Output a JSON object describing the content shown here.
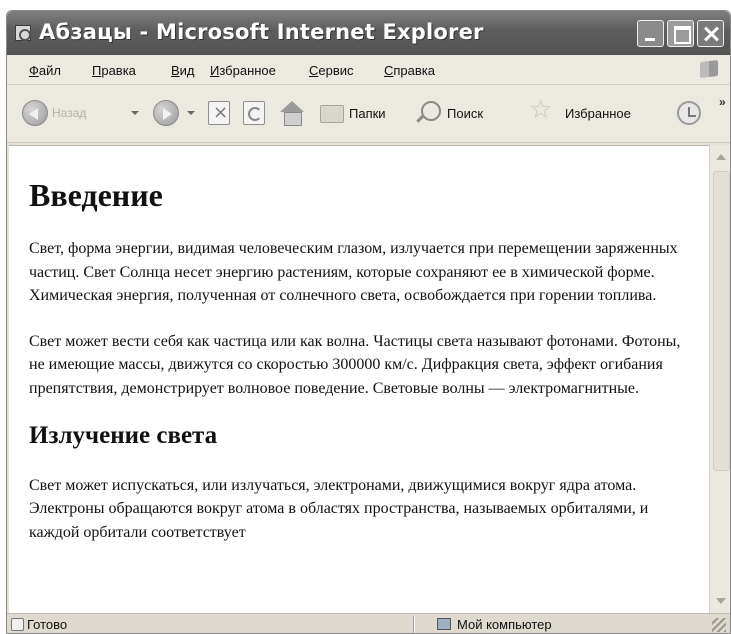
{
  "window": {
    "title": "Абзацы - Microsoft Internet Explorer"
  },
  "menu": {
    "items": [
      "Файл",
      "Правка",
      "Вид",
      "Избранное",
      "Сервис",
      "Справка"
    ]
  },
  "toolbar": {
    "back_label": "Назад",
    "folders_label": "Папки",
    "search_label": "Поиск",
    "favorites_label": "Избранное"
  },
  "content": {
    "heading1": "Введение",
    "paragraph1": "Свет, форма энергии, видимая человеческим глазом, излучается при перемещении заряженных частиц. Свет Солнца несет энергию растениям, которые сохраняют ее в химической форме. Химическая энергия, полученная от солнечного света, освобождается при горении топлива.",
    "paragraph2": "Свет может вести себя как частица или как волна. Частицы света называют фотонами. Фотоны, не имеющие массы, движутся со скоростью 300000 км/с. Дифракция света, эффект огибания препятствия, демонстрирует волновое поведение. Световые волны — электромагнитные.",
    "heading2": "Излучение света",
    "paragraph3": "Свет может испускаться, или излучаться, электронами, движущимися вокруг ядра атома. Электроны обращаются вокруг атома в областях пространства, называемых орбиталями, и каждой орбитали соответствует"
  },
  "status": {
    "text": "Готово",
    "zone": "Мой компьютер"
  },
  "icons": {
    "back": "back-arrow-icon",
    "forward": "forward-arrow-icon",
    "stop": "stop-icon",
    "refresh": "refresh-icon",
    "home": "home-icon",
    "folders": "folder-icon",
    "search": "search-icon",
    "favorites": "star-icon",
    "history": "history-icon"
  }
}
